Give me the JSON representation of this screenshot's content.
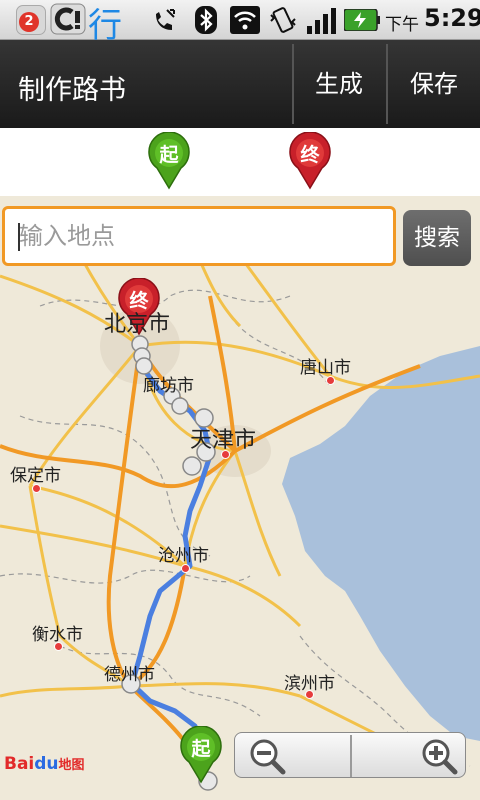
{
  "status_bar": {
    "notification_count": "2",
    "app_glyph": "行",
    "time_period": "下午",
    "time": "5:29",
    "icons": [
      "notification-badge",
      "c-app-icon",
      "xing-app-icon",
      "missed-call-icon",
      "bluetooth-icon",
      "wifi-icon",
      "vibrate-icon",
      "signal-icon",
      "battery-charging-icon"
    ]
  },
  "title_bar": {
    "title": "制作路书",
    "generate_label": "生成",
    "save_label": "保存"
  },
  "markers": {
    "start_label": "起",
    "end_label": "终",
    "start_color": "#4ca31c",
    "end_color": "#c8202a"
  },
  "search": {
    "placeholder": "输入地点",
    "value": "",
    "button_label": "搜索"
  },
  "map": {
    "cities": [
      {
        "name": "北京市"
      },
      {
        "name": "廊坊市"
      },
      {
        "name": "唐山市"
      },
      {
        "name": "天津市"
      },
      {
        "name": "保定市"
      },
      {
        "name": "沧州市"
      },
      {
        "name": "衡水市"
      },
      {
        "name": "德州市"
      },
      {
        "name": "滨州市"
      }
    ],
    "route_color": "#4b7fe0",
    "logo_bai": "Bai",
    "logo_du": "du",
    "logo_ditu": "地图"
  },
  "zoom": {
    "zoom_out_icon": "zoom-out-icon",
    "zoom_in_icon": "zoom-in-icon"
  }
}
